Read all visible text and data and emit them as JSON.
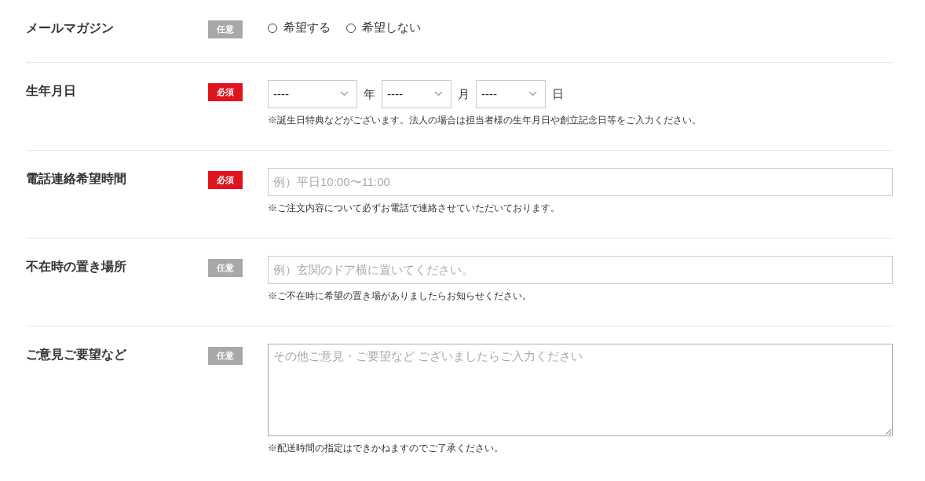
{
  "fields": [
    {
      "kind": "radio",
      "label": "メールマガジン",
      "badge": {
        "text": "任意",
        "required": false
      },
      "options": [
        {
          "label": "希望する",
          "selected": false
        },
        {
          "label": "希望しない",
          "selected": false
        }
      ]
    },
    {
      "kind": "date",
      "label": "生年月日",
      "badge": {
        "text": "必須",
        "required": true
      },
      "parts": [
        {
          "value": "----",
          "unit": "年"
        },
        {
          "value": "----",
          "unit": "月"
        },
        {
          "value": "----",
          "unit": "日"
        }
      ],
      "note": "※誕生日特典などがございます。法人の場合は担当者様の生年月日や創立記念日等をご入力ください。"
    },
    {
      "kind": "text",
      "label": "電話連絡希望時間",
      "badge": {
        "text": "必須",
        "required": true
      },
      "placeholder": "例）平日10:00〜11:00",
      "note": "※ご注文内容について必ずお電話で連絡させていただいております。"
    },
    {
      "kind": "text",
      "label": "不在時の置き場所",
      "badge": {
        "text": "任意",
        "required": false
      },
      "placeholder": "例）玄関のドア横に置いてください。",
      "note": "※ご不在時に希望の置き場がありましたらお知らせください。"
    },
    {
      "kind": "textarea",
      "label": "ご意見ご要望など",
      "badge": {
        "text": "任意",
        "required": false
      },
      "placeholder": "その他ご意見・ご要望など ございましたらご入力ください",
      "note": "※配送時間の指定はできかねますのでご了承ください。"
    }
  ]
}
